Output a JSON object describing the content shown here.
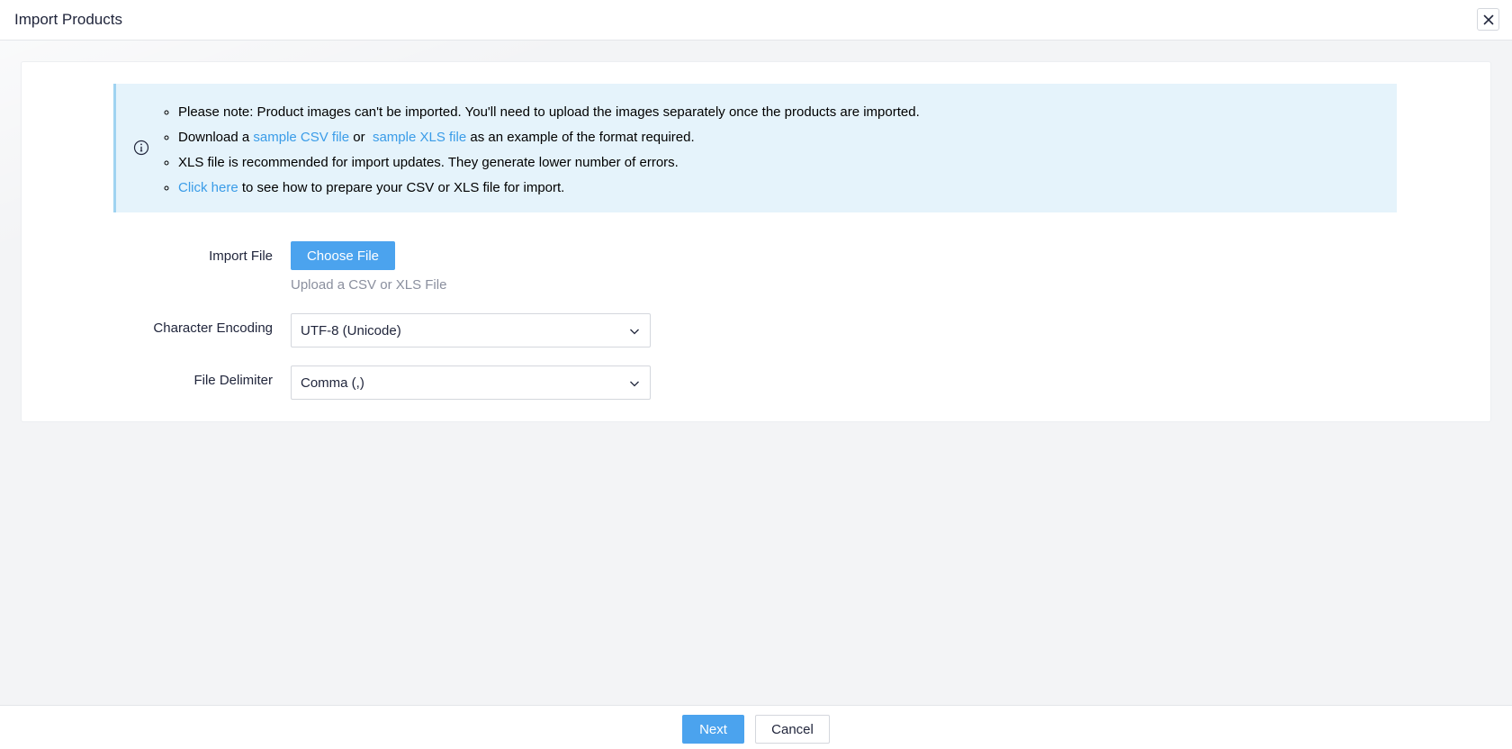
{
  "header": {
    "title": "Import Products",
    "close_icon": "close-icon"
  },
  "notice": {
    "icon": "info-icon",
    "items": [
      {
        "text": "Please note: Product images can't be imported. You'll need to upload the images separately once the products are imported."
      },
      {
        "prefix": "Download a ",
        "link1": "sample CSV file",
        "middle": " or ",
        "link2": "sample XLS file",
        "suffix": " as an example of the format required."
      },
      {
        "text": "XLS file is recommended for import updates. They generate lower number of errors."
      },
      {
        "link": "Click here",
        "suffix": " to see how to prepare your CSV or XLS file for import."
      }
    ]
  },
  "form": {
    "import_file": {
      "label": "Import File",
      "button_label": "Choose File",
      "help": "Upload a CSV or XLS File"
    },
    "character_encoding": {
      "label": "Character Encoding",
      "selected": "UTF-8 (Unicode)"
    },
    "file_delimiter": {
      "label": "File Delimiter",
      "selected": "Comma (,)"
    }
  },
  "footer": {
    "next_label": "Next",
    "cancel_label": "Cancel"
  },
  "colors": {
    "accent": "#4ba3ee",
    "link": "#3a9ce8",
    "notice_bg": "#e5f3fb",
    "notice_border": "#9fd3f1"
  }
}
